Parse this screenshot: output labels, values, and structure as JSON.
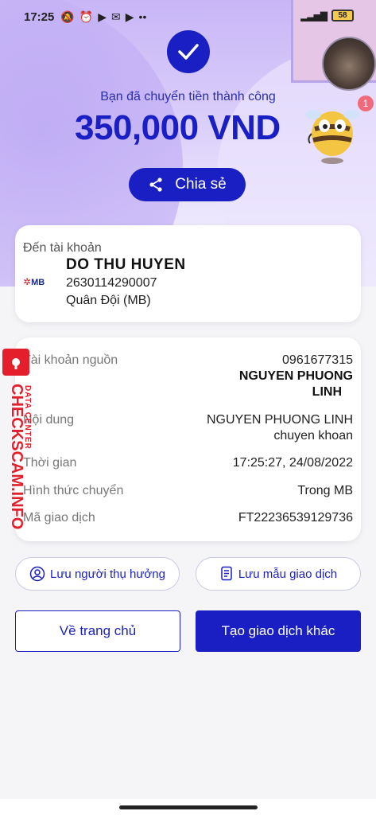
{
  "status_bar": {
    "time": "17:25",
    "battery": "58"
  },
  "header": {
    "success_message": "Bạn đã chuyển tiền thành công",
    "amount": "350,000 VND",
    "share_label": "Chia sẻ",
    "notification_count": "1"
  },
  "recipient": {
    "to_label": "Đến tài khoản",
    "bank_logo": "MB",
    "name": "DO THU HUYEN",
    "account_number": "2630114290007",
    "bank_name": "Quân Đội (MB)"
  },
  "details": {
    "source_label": "Tài khoản nguồn",
    "source_account": "0961677315",
    "source_name_line1": "NGUYEN PHUONG",
    "source_name_line2": "LINH",
    "content_label": "Nội dung",
    "content_line1": "NGUYEN PHUONG LINH",
    "content_line2": "chuyen khoan",
    "time_label": "Thời gian",
    "time_value": "17:25:27, 24/08/2022",
    "method_label": "Hình thức chuyển",
    "method_value": "Trong MB",
    "txn_label": "Mã giao dịch",
    "txn_value": "FT22236539129736"
  },
  "actions": {
    "save_beneficiary": "Lưu người thụ hưởng",
    "save_template": "Lưu mẫu giao dịch",
    "home": "Về trang chủ",
    "new_transaction": "Tạo giao dịch khác"
  },
  "watermark": {
    "brand": "CHECKSCAM.INFO",
    "sub": "DATA CENTER"
  },
  "colors": {
    "primary": "#1a1fc4",
    "watermark": "#e41e2b"
  }
}
